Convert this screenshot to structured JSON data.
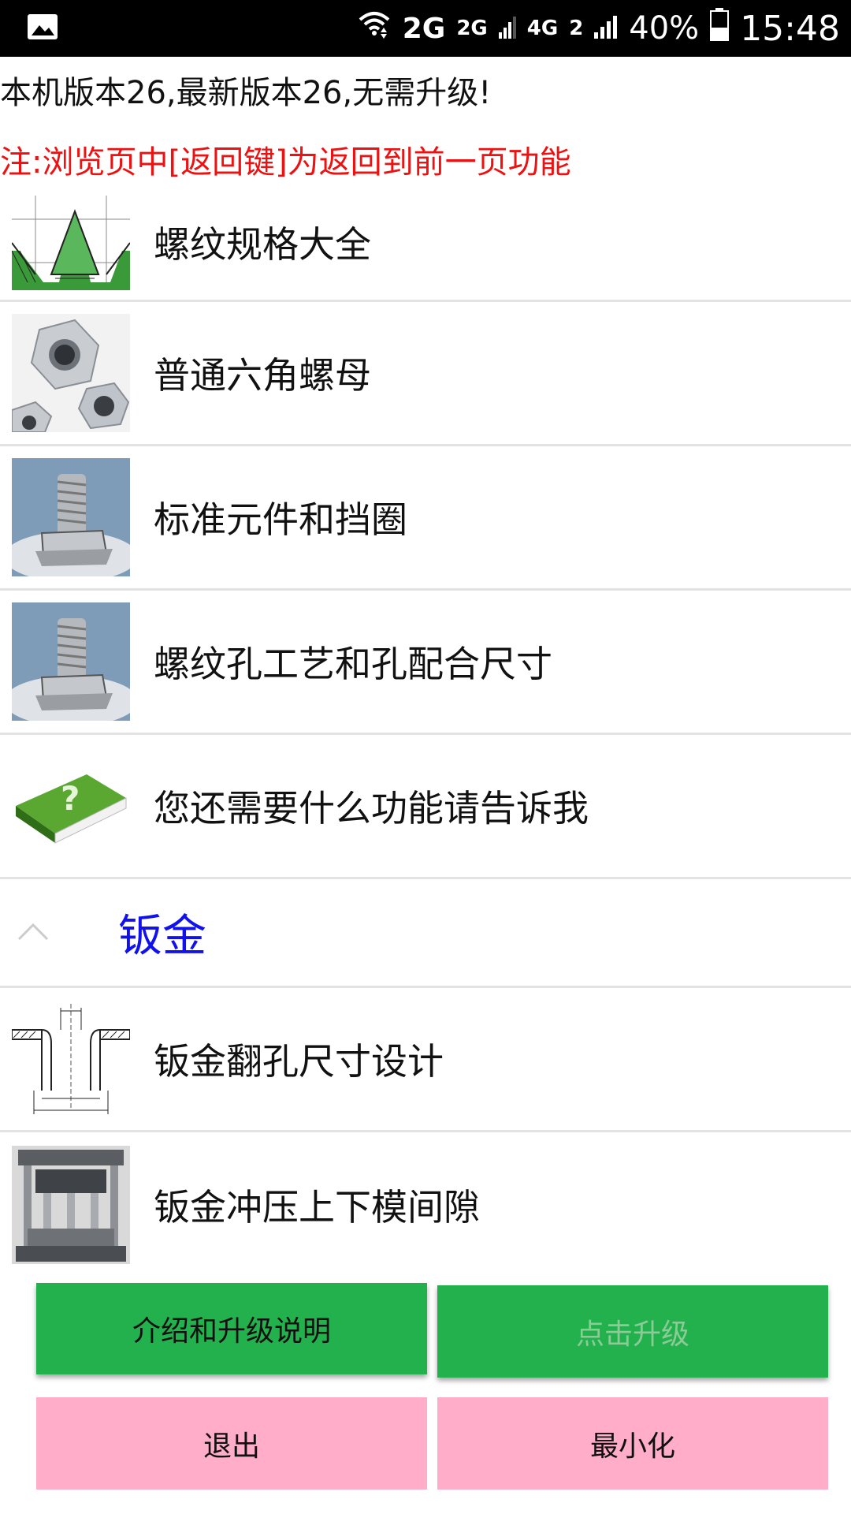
{
  "status_bar": {
    "network_2g": "2G",
    "network_2g_small": "2G",
    "network_4g": "4G",
    "network_2_small": "2",
    "battery": "40%",
    "time": "15:48",
    "icons": [
      "image-icon",
      "wifi-icon",
      "signal-icon",
      "battery-icon"
    ]
  },
  "version_text": "本机版本26,最新版本26,无需升级!",
  "note_text": "注:浏览页中[返回键]为返回到前一页功能",
  "items": [
    {
      "label": "螺纹规格大全",
      "icon": "thread-spec-diagram"
    },
    {
      "label": "普通六角螺母",
      "icon": "hex-nut-photo"
    },
    {
      "label": "标准元件和挡圈",
      "icon": "bolt-photo"
    },
    {
      "label": "螺纹孔工艺和孔配合尺寸",
      "icon": "bolt-photo"
    },
    {
      "label": "您还需要什么功能请告诉我",
      "icon": "green-help-book"
    }
  ],
  "section": {
    "title": "钣金",
    "icon": "chevron-up-icon"
  },
  "section_items": [
    {
      "label": "钣金翻孔尺寸设计",
      "icon": "flange-hole-diagram"
    },
    {
      "label": "钣金冲压上下模间隙",
      "icon": "press-die-photo"
    }
  ],
  "buttons": {
    "intro": "介绍和升级说明",
    "upgrade": "点击升级",
    "exit": "退出",
    "minimize": "最小化"
  },
  "colors": {
    "green_button": "#23b14d",
    "pink_button": "#ffadc9",
    "section_title": "#1111ee",
    "note_text": "#ee1111"
  }
}
